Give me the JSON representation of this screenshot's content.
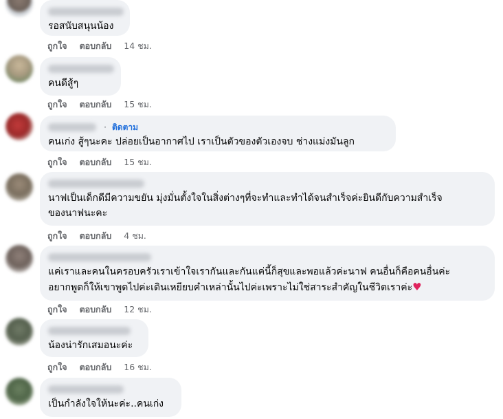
{
  "labels": {
    "like": "ถูกใจ",
    "reply": "ตอบกลับ",
    "follow": "ติดตาม",
    "dot": "·"
  },
  "comments": [
    {
      "text": "รอสนับสนุนน้อง",
      "time": "14 ชม."
    },
    {
      "text": "คนดีสู้ๆ",
      "time": "15 ชม."
    },
    {
      "text": "คนเก่ง สู้ๆนะคะ ปล่อยเป็นอากาศไป เราเป็นตัวของตัวเองจบ ช่างแม่งมันลูก",
      "time": "15 ชม."
    },
    {
      "text": "นาฟเป็นเด็กดีมีความขยัน มุ่งมั่นตั้งใจในสิ่งต่างๆที่จะทำและทำได้จนสำเร็จค่ะยินดีกับความสำเร็จ\nของนาฟนะคะ",
      "time": "4 ชม."
    },
    {
      "text": "แค่เราและคนในครอบครัวเราเข้าใจเรากันและกันแค่นี้ก็สุขและพอแล้วค่ะนาฟ คนอื่นก็คือคนอื่นค่ะ\nอยากพูดก็ให้เขาพูดไปค่ะเดินเหยียบคำเหล่านั้นไปค่ะเพราะไม่ใช่สาระสำคัญในชีวิตเราค่ะ",
      "heart": "♥",
      "time": "12 ชม."
    },
    {
      "text": "น้องน่ารักเสมอนะค่ะ",
      "time": "16 ชม."
    },
    {
      "text": "เป็นกำลังใจให้นะค่ะ..คนเก่ง"
    }
  ],
  "colors": {
    "bubble": "#f0f2f5",
    "text": "#050505",
    "meta": "#65676b",
    "follow": "#216fdb",
    "heart": "#e0245e"
  }
}
